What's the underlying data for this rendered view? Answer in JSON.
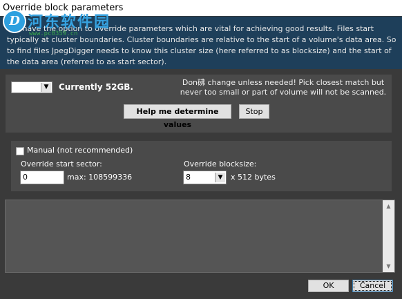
{
  "window": {
    "title": "Override block parameters"
  },
  "intro": {
    "text": "You have the option to override parameters which are vital for achieving good results. Files start typically at cluster boundaries. Cluster boundaries are relative to the start of a volume's data area. So to find files JpegDigger needs to know this cluster size (here referred to as blocksize) and the start of the data area (referred to as start sector)."
  },
  "watermark": {
    "logo_letter": "D",
    "name": "河东软件园",
    "url": "www.pc0359.cn"
  },
  "size": {
    "selected": "",
    "currently_label": "Currently 52GB."
  },
  "warning": {
    "text": "Don砩 change unless needed! Pick closest match but never too small or part of volume will not be scanned."
  },
  "buttons": {
    "help": "Help me determine values",
    "stop": "Stop",
    "ok": "OK",
    "cancel": "Cancel"
  },
  "manual": {
    "checkbox_label": "Manual (not recommended)",
    "checked": false,
    "start_sector_label": "Override start sector:",
    "start_sector_value": "0",
    "max_label": "max: 108599336",
    "blocksize_label": "Override blocksize:",
    "blocksize_value": "8",
    "unit_label": "x 512 bytes"
  },
  "log": {
    "text": ""
  }
}
